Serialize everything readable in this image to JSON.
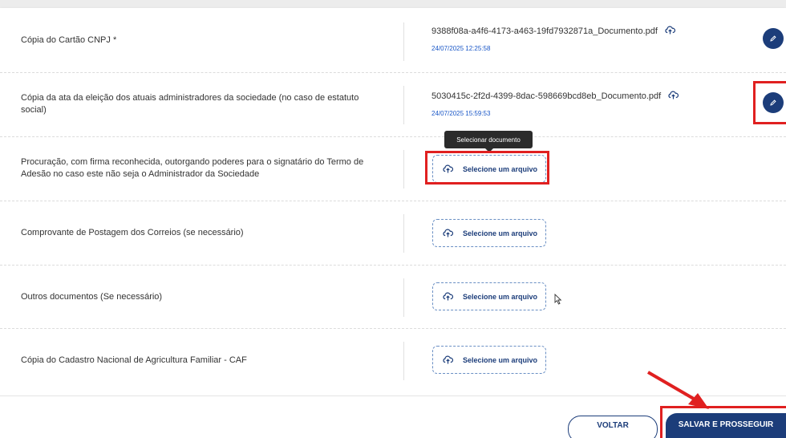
{
  "documents": [
    {
      "label": "Cópia do Cartão CNPJ *",
      "file": "9388f08a-a4f6-4173-a463-19fd7932871a_Documento.pdf",
      "date": "24/07/2025 12:25:58"
    },
    {
      "label": "Cópia da ata da eleição dos atuais administradores da sociedade (no caso de estatuto social)",
      "file": "5030415c-2f2d-4399-8dac-598669bcd8eb_Documento.pdf",
      "date": "24/07/2025 15:59:53"
    },
    {
      "label": "Procuração, com firma reconhecida, outorgando poderes para o signatário do Termo de Adesão no caso este não seja o Administrador da Sociedade",
      "upload_label": "Selecione um arquivo"
    },
    {
      "label": "Comprovante de Postagem dos Correios (se necessário)",
      "upload_label": "Selecione um arquivo"
    },
    {
      "label": "Outros documentos (Se necessário)",
      "upload_label": "Selecione um arquivo"
    },
    {
      "label": "Cópia do Cadastro Nacional de Agricultura Familiar - CAF",
      "upload_label": "Selecione um arquivo"
    }
  ],
  "tooltip": "Selecionar documento",
  "buttons": {
    "back": "VOLTAR",
    "save": "SALVAR E PROSSEGUIR"
  },
  "colors": {
    "primary": "#1c3d7a",
    "highlight": "#e02020",
    "date": "#1a57c7"
  },
  "icons": {
    "upload": "cloud-upload-icon",
    "edit": "pencil-icon"
  }
}
